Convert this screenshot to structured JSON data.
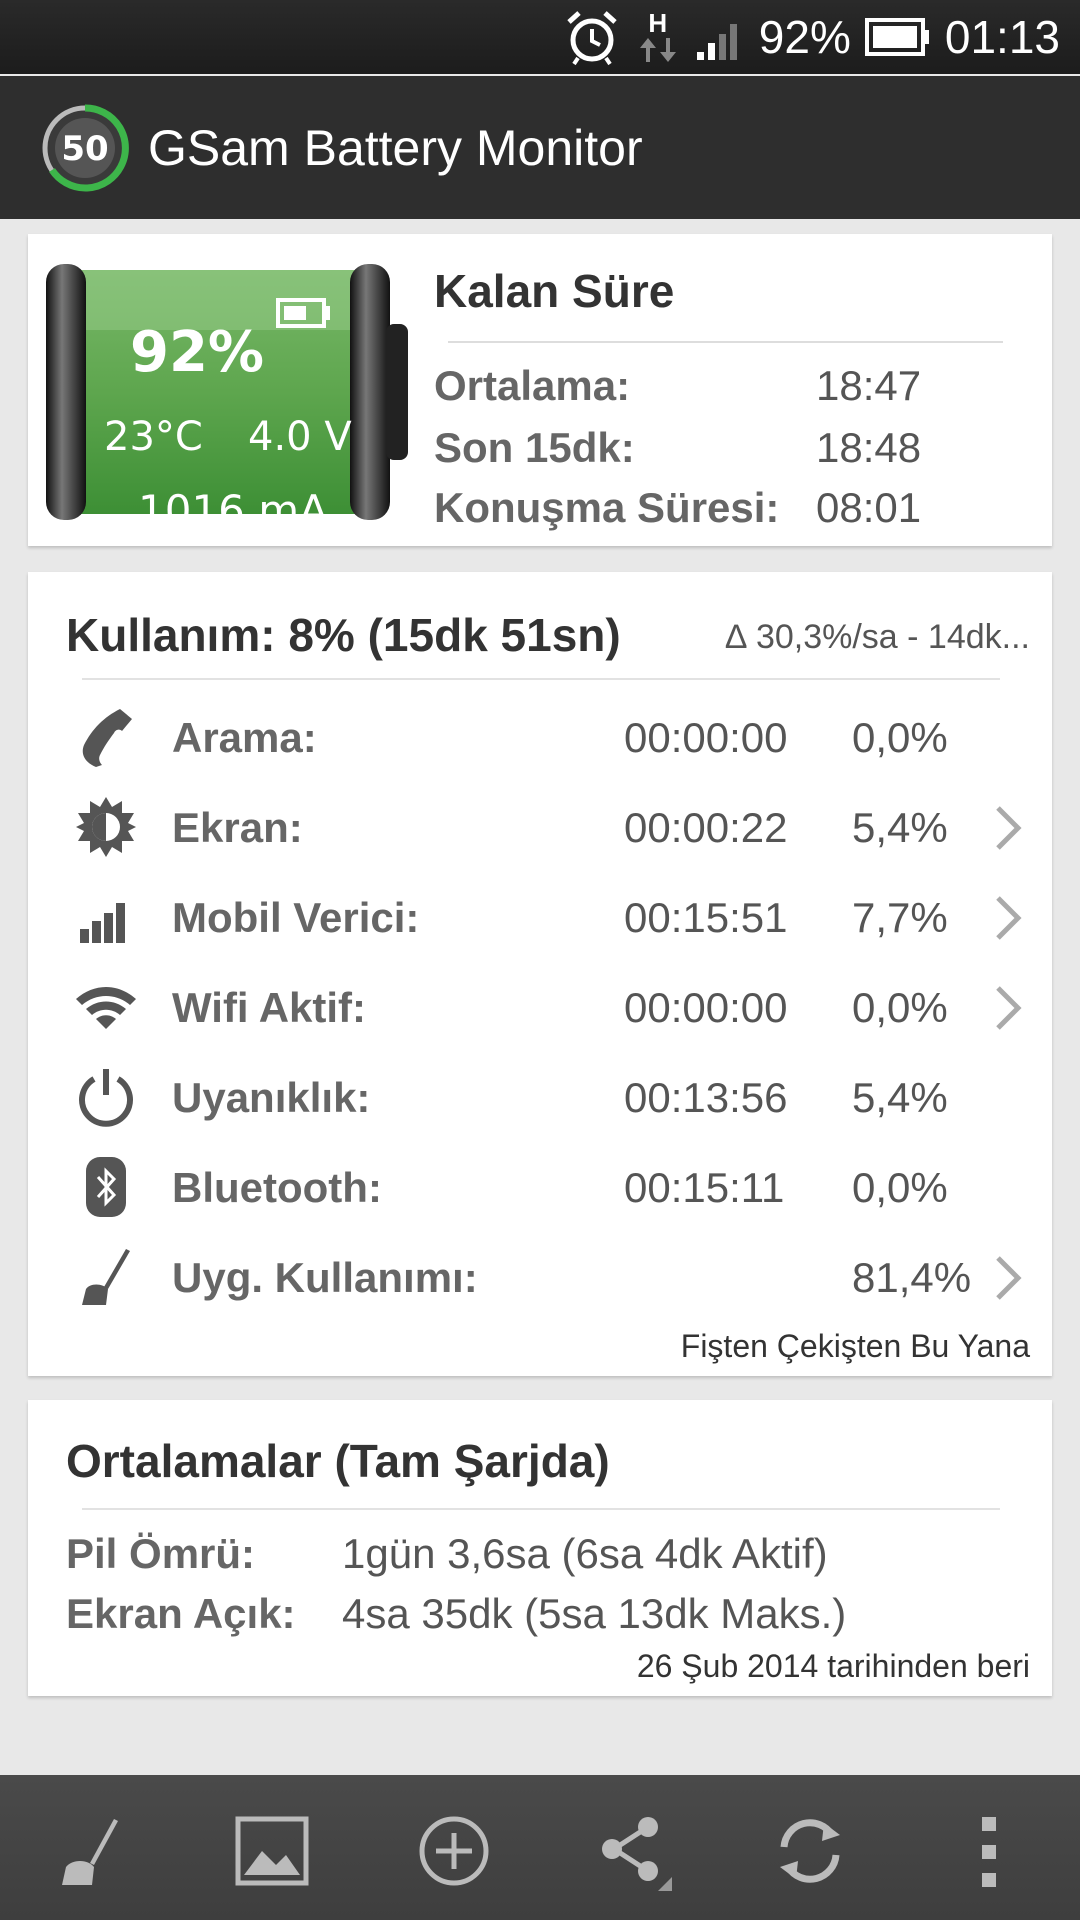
{
  "status_bar": {
    "network": "H",
    "battery_percent": "92%",
    "time": "01:13"
  },
  "app": {
    "title": "GSam Battery Monitor",
    "icon_value": "50"
  },
  "battery": {
    "percent": "92%",
    "temperature": "23°C",
    "voltage": "4.0 V",
    "current": "1016 mA"
  },
  "remaining": {
    "title": "Kalan Süre",
    "rows": [
      {
        "label": "Ortalama:",
        "value": "18:47"
      },
      {
        "label": "Son 15dk:",
        "value": "18:48"
      },
      {
        "label": "Konuşma Süresi:",
        "value": "08:01"
      }
    ]
  },
  "usage": {
    "title": "Kullanım: 8% (15dk 51sn)",
    "rate": "∆ 30,3%/sa - 14dk...",
    "rows": [
      {
        "icon": "phone-icon",
        "label": "Arama:",
        "time": "00:00:00",
        "percent": "0,0%",
        "has_detail": false
      },
      {
        "icon": "brightness-icon",
        "label": "Ekran:",
        "time": "00:00:22",
        "percent": "5,4%",
        "has_detail": true
      },
      {
        "icon": "signal-icon",
        "label": "Mobil Verici:",
        "time": "00:15:51",
        "percent": "7,7%",
        "has_detail": true
      },
      {
        "icon": "wifi-icon",
        "label": "Wifi Aktif:",
        "time": "00:00:00",
        "percent": "0,0%",
        "has_detail": true
      },
      {
        "icon": "power-icon",
        "label": "Uyanıklık:",
        "time": "00:13:56",
        "percent": "5,4%",
        "has_detail": false
      },
      {
        "icon": "bluetooth-icon",
        "label": "Bluetooth:",
        "time": "00:15:11",
        "percent": "0,0%",
        "has_detail": false
      },
      {
        "icon": "broom-icon",
        "label": "Uyg. Kullanımı:",
        "time": "",
        "percent": "81,4%",
        "has_detail": true
      }
    ],
    "footer": "Fişten Çekişten Bu Yana"
  },
  "averages": {
    "title": "Ortalamalar (Tam Şarjda)",
    "rows": [
      {
        "label": "Pil Ömrü:",
        "value": "1gün 3,6sa (6sa 4dk Aktif)"
      },
      {
        "label": "Ekran Açık:",
        "value": "4sa 35dk (5sa 13dk Maks.)"
      }
    ],
    "footer": "26 Şub 2014 tarihinden beri"
  },
  "bottom_bar": [
    "broom-icon",
    "image-icon",
    "add-icon",
    "share-icon",
    "refresh-icon",
    "overflow-menu-icon"
  ],
  "colors": {
    "accent_green": "#3db54a",
    "action_bar": "#2e2e2e",
    "bottom_bar": "#444444",
    "background": "#e8e8e8"
  }
}
